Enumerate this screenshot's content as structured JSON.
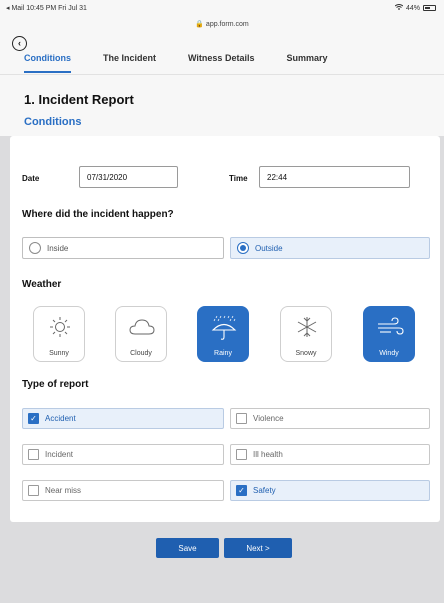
{
  "status": {
    "left": "◂ Mail  10:45 PM  Fri Jul 31",
    "url": "🔒 app.form.com",
    "battery": "44%"
  },
  "tabs": [
    "Conditions",
    "The Incident",
    "Witness Details",
    "Summary"
  ],
  "page_title": "1. Incident Report",
  "section_title": "Conditions",
  "date": {
    "label": "Date",
    "value": "07/31/2020"
  },
  "time": {
    "label": "Time",
    "value": "22:44"
  },
  "location": {
    "question": "Where did the incident happen?",
    "options": [
      {
        "label": "Inside",
        "selected": false
      },
      {
        "label": "Outside",
        "selected": true
      }
    ]
  },
  "weather": {
    "label": "Weather",
    "options": [
      {
        "label": "Sunny",
        "icon": "sun-icon",
        "selected": false
      },
      {
        "label": "Cloudy",
        "icon": "cloud-icon",
        "selected": false
      },
      {
        "label": "Rainy",
        "icon": "umbrella-rain-icon",
        "selected": true
      },
      {
        "label": "Snowy",
        "icon": "snowflake-icon",
        "selected": false
      },
      {
        "label": "Windy",
        "icon": "wind-icon",
        "selected": true
      }
    ]
  },
  "report_type": {
    "label": "Type of report",
    "options": [
      {
        "label": "Accident",
        "selected": true
      },
      {
        "label": "Violence",
        "selected": false
      },
      {
        "label": "Incident",
        "selected": false
      },
      {
        "label": "Ill health",
        "selected": false
      },
      {
        "label": "Near miss",
        "selected": false
      },
      {
        "label": "Safety",
        "selected": true
      }
    ]
  },
  "buttons": {
    "save": "Save",
    "next": "Next >"
  },
  "colors": {
    "accent": "#2a6fc4",
    "button": "#1f5fb0",
    "selected_bg": "#e8f0fa"
  }
}
